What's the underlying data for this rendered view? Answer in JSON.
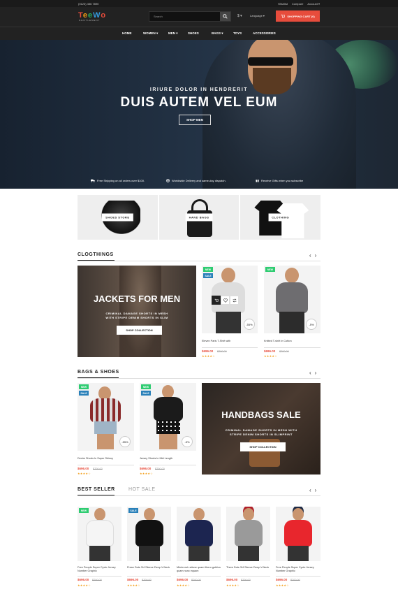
{
  "topbar": {
    "phone": "(0123) 456 7890",
    "wishlist": "Wishlist",
    "compare": "Compare",
    "account": "Account ▾"
  },
  "header": {
    "logo_text": "TeeWo",
    "logo_sub": "GENTLEMENT",
    "search_placeholder": "Search",
    "currency": "$ ▾",
    "language": "Language ▾",
    "cart_label": "SHOPPING CART (0)"
  },
  "nav": [
    "HOME",
    "WOMEN",
    "MEN",
    "SHOES",
    "BAGS",
    "TOYS",
    "ACCESSORIES"
  ],
  "hero": {
    "subtitle": "IRIURE DOLOR IN HENDRERIT",
    "title": "DUIS AUTEM VEL EUM",
    "button": "SHOP MEN"
  },
  "features": [
    "Free Shipping on all orders over $100.",
    "Worldwide Delivery and same-day dispatch.",
    "Receive Gifts when you subscribe"
  ],
  "banners": [
    "SHOES STORE",
    "HAND BAGS",
    "CLOTHING"
  ],
  "clothing": {
    "title": "CLOGTHINGS",
    "promo": {
      "title": "JACKETS FOR MEN",
      "desc1": "CRIMINAL DAMAGE SHORTS IN MESH",
      "desc2": "WITH STRIPE DENIM SHORTS IN SLIM",
      "button": "SHOP COLLECTION"
    },
    "products": [
      {
        "name": "Eleven Paris T-Shirt with",
        "price": "$696.00",
        "old": "$700.00",
        "discount": "-55%",
        "badges": [
          "NEW",
          "SALE"
        ]
      },
      {
        "name": "Knitted T-shirt in Cotton",
        "price": "$696.00",
        "old": "$700.00",
        "discount": "-5%",
        "badges": [
          "NEW"
        ]
      }
    ]
  },
  "bags": {
    "title": "BAGS & SHOES",
    "products": [
      {
        "name": "Denim Shorts In Super Skinny",
        "price": "$696.00",
        "old": "$700.00",
        "discount": "-55%",
        "badges": [
          "NEW",
          "SALE"
        ]
      },
      {
        "name": "Jersey Shorts In Mid Length",
        "price": "$696.00",
        "old": "$700.00",
        "discount": "-5%",
        "badges": [
          "NEW",
          "SALE"
        ]
      }
    ],
    "promo": {
      "title": "HANDBAGS SALE",
      "desc1": "CRIMINAL DAMAGE SHORTS IN MESH WITH",
      "desc2": "STRIPE DENIM SHORTS IN SLIMPRINT",
      "button": "SHOP COLLECTION"
    }
  },
  "bestseller": {
    "tab_active": "BEST SELLER",
    "tab_inactive": "HOT SALE",
    "products": [
      {
        "name": "Free People Super Cyclo Jersey Number Graphic",
        "price": "$696.00",
        "old": "$700.00",
        "badges": [
          "NEW"
        ]
      },
      {
        "name": "Prese Dots 3/4 Sleeve Deep V-Neck",
        "price": "$696.00",
        "old": "$700.00",
        "badges": [
          "SALE"
        ]
      },
      {
        "name": "Minim est ratione quam libero gothics quam nunc equam",
        "price": "$696.00",
        "old": "$700.00",
        "badges": []
      },
      {
        "name": "Three Dots 3/4 Sleeve Deep V-Neck",
        "price": "$696.00",
        "old": "$700.00",
        "badges": []
      },
      {
        "name": "Free People Super Cyclo Jersey Number Graphic",
        "price": "$696.00",
        "old": "$700.00",
        "badges": []
      }
    ]
  },
  "stars": "★★★★☆",
  "colors": {
    "accent": "#e74c3c",
    "new_badge": "#2ecc71",
    "sale_badge": "#2980b9",
    "header": "#222222"
  }
}
